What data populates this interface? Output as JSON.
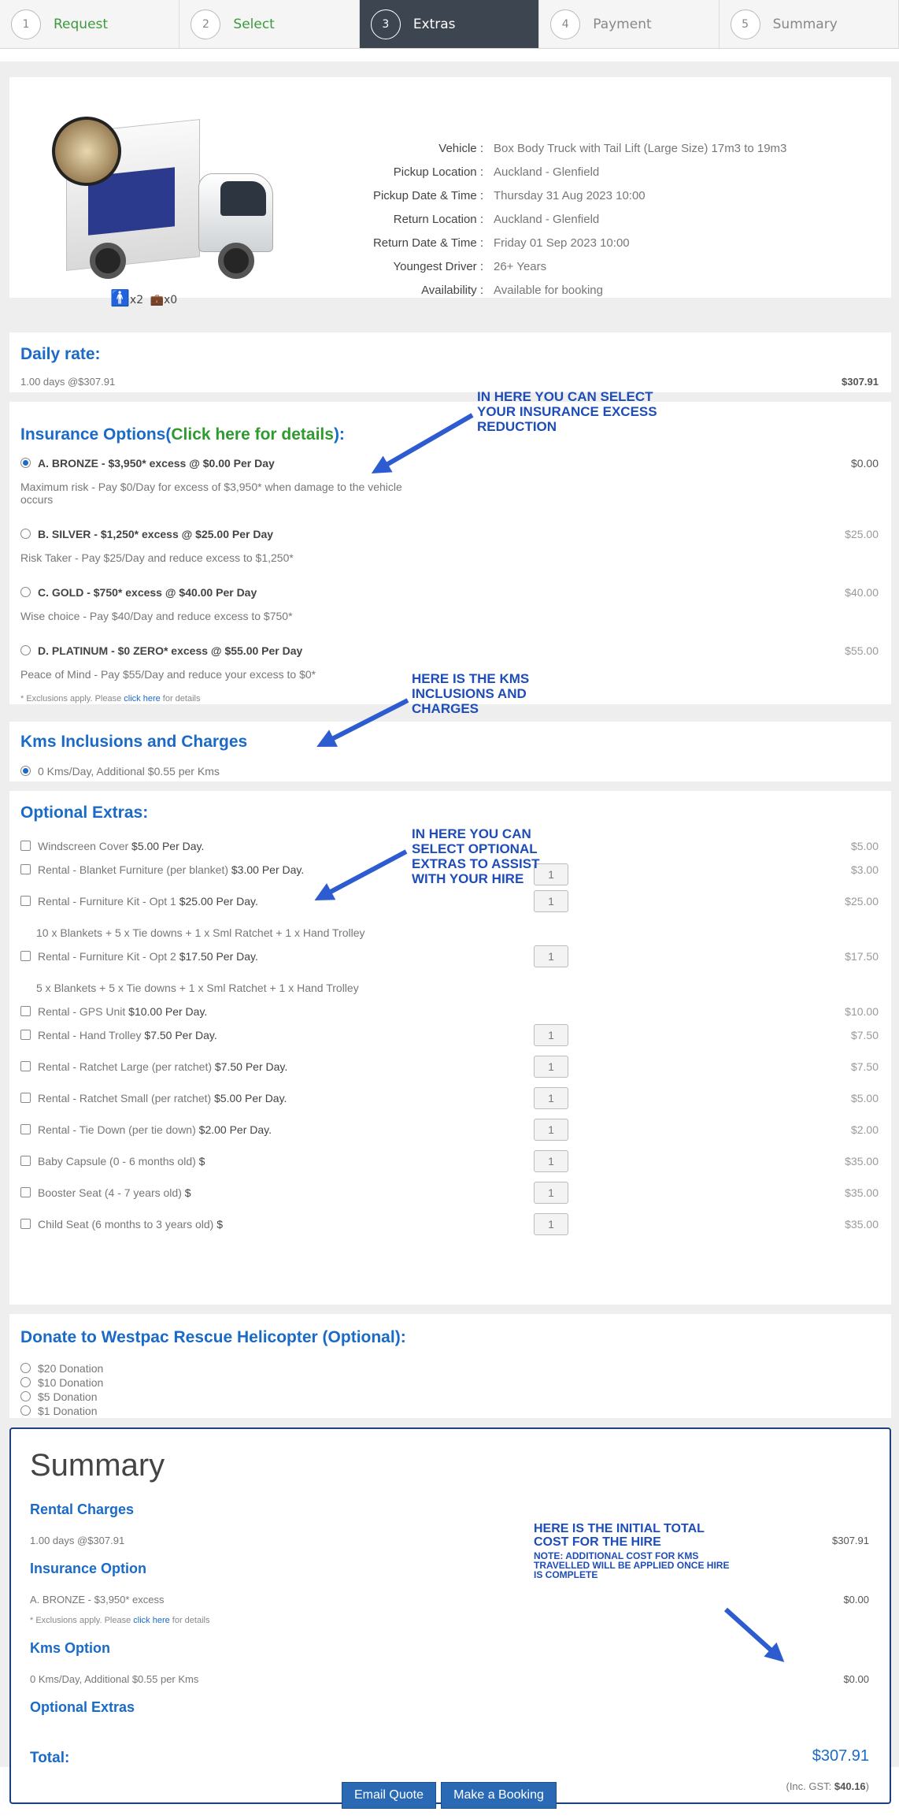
{
  "steps": [
    {
      "num": "1",
      "label": "Request"
    },
    {
      "num": "2",
      "label": "Select"
    },
    {
      "num": "3",
      "label": "Extras"
    },
    {
      "num": "4",
      "label": "Payment"
    },
    {
      "num": "5",
      "label": "Summary"
    }
  ],
  "vehicle": {
    "passengers": "x2",
    "luggage": "x0",
    "rows": [
      {
        "label": "Vehicle :",
        "value": "Box Body Truck with Tail Lift (Large Size) 17m3 to 19m3"
      },
      {
        "label": "Pickup Location :",
        "value": "Auckland - Glenfield"
      },
      {
        "label": "Pickup Date & Time :",
        "value": "Thursday 31 Aug 2023 10:00"
      },
      {
        "label": "Return Location :",
        "value": "Auckland - Glenfield"
      },
      {
        "label": "Return Date & Time :",
        "value": "Friday 01 Sep 2023 10:00"
      },
      {
        "label": "Youngest Driver :",
        "value": "26+ Years"
      },
      {
        "label": "Availability :",
        "value": "Available for booking"
      }
    ]
  },
  "daily": {
    "title": "Daily rate:",
    "desc": "1.00 days @$307.91",
    "price": "$307.91"
  },
  "insurance": {
    "title_a": "Insurance Options(",
    "title_link": "Click here for details",
    "title_b": "):",
    "options": [
      {
        "label": "A. BRONZE - $3,950* excess @ $0.00 Per Day",
        "desc": "Maximum risk - Pay $0/Day for excess of $3,950* when damage to the vehicle occurs",
        "price": "$0.00"
      },
      {
        "label": "B. SILVER - $1,250* excess @ $25.00 Per Day",
        "desc": "Risk Taker - Pay $25/Day and reduce excess to $1,250*",
        "price": "$25.00"
      },
      {
        "label": "C. GOLD - $750* excess @ $40.00 Per Day",
        "desc": "Wise choice - Pay $40/Day and reduce excess to $750*",
        "price": "$40.00"
      },
      {
        "label": "D. PLATINUM - $0 ZERO* excess @ $55.00 Per Day",
        "desc": "Peace of Mind - Pay $55/Day and reduce your excess to $0*",
        "price": "$55.00"
      }
    ],
    "excl_a": "* Exclusions apply. Please ",
    "excl_link": "click here",
    "excl_b": " for details"
  },
  "kms": {
    "title": "Kms Inclusions and Charges",
    "option": "0 Kms/Day, Additional $0.55 per Kms"
  },
  "extras": {
    "title": "Optional Extras:",
    "items": [
      {
        "name": "Windscreen Cover",
        "price_text": "$5.00 Per Day.",
        "price": "$5.00",
        "qty": ""
      },
      {
        "name": "Rental - Blanket Furniture (per blanket)",
        "price_text": "$3.00 Per Day.",
        "price": "$3.00",
        "qty": "1"
      },
      {
        "name": "Rental - Furniture Kit - Opt 1",
        "price_text": "$25.00 Per Day.",
        "price": "$25.00",
        "qty": "1",
        "sub": "10 x Blankets + 5 x Tie downs + 1 x Sml Ratchet + 1 x Hand Trolley"
      },
      {
        "name": "Rental - Furniture Kit - Opt 2",
        "price_text": "$17.50 Per Day.",
        "price": "$17.50",
        "qty": "1",
        "sub": "5 x Blankets + 5 x Tie downs + 1 x Sml Ratchet + 1 x Hand Trolley"
      },
      {
        "name": "Rental - GPS Unit",
        "price_text": "$10.00 Per Day.",
        "price": "$10.00",
        "qty": ""
      },
      {
        "name": "Rental - Hand Trolley",
        "price_text": "$7.50 Per Day.",
        "price": "$7.50",
        "qty": "1"
      },
      {
        "name": "Rental - Ratchet Large (per ratchet)",
        "price_text": "$7.50 Per Day.",
        "price": "$7.50",
        "qty": "1"
      },
      {
        "name": "Rental - Ratchet Small (per ratchet)",
        "price_text": "$5.00 Per Day.",
        "price": "$5.00",
        "qty": "1"
      },
      {
        "name": "Rental - Tie Down (per tie down)",
        "price_text": "$2.00 Per Day.",
        "price": "$2.00",
        "qty": "1"
      },
      {
        "name": "Baby Capsule (0 - 6 months old)",
        "price_text": "$",
        "price": "$35.00",
        "qty": "1"
      },
      {
        "name": "Booster Seat (4 - 7 years old)",
        "price_text": "$",
        "price": "$35.00",
        "qty": "1"
      },
      {
        "name": "Child Seat (6 months to 3 years old)",
        "price_text": "$",
        "price": "$35.00",
        "qty": "1"
      }
    ]
  },
  "donate": {
    "title": "Donate to Westpac Rescue Helicopter (Optional):",
    "options": [
      "$20 Donation",
      "$10 Donation",
      "$5 Donation",
      "$1 Donation"
    ]
  },
  "summary": {
    "title": "Summary",
    "rental_h": "Rental Charges",
    "rental_desc": "1.00 days @$307.91",
    "rental_price": "$307.91",
    "ins_h": "Insurance Option",
    "ins_desc": "A. BRONZE - $3,950* excess",
    "ins_price": "$0.00",
    "excl_a": "* Exclusions apply. Please ",
    "excl_link": "click here",
    "excl_b": " for details",
    "kms_h": "Kms Option",
    "kms_desc": "0 Kms/Day, Additional $0.55 per Kms",
    "kms_price": "$0.00",
    "extras_h": "Optional Extras",
    "total_label": "Total:",
    "total": "$307.91",
    "gst_a": "(Inc. GST: ",
    "gst_val": "$40.16",
    "gst_b": ")"
  },
  "notes": {
    "insurance": "IN HERE YOU CAN SELECT YOUR INSURANCE EXCESS REDUCTION",
    "kms": "HERE IS THE KMS INCLUSIONS AND CHARGES",
    "extras": "IN HERE YOU CAN SELECT OPTIONAL EXTRAS TO ASSIST WITH YOUR HIRE",
    "total": "HERE IS THE INITIAL TOTAL COST FOR THE HIRE",
    "total_sub": "NOTE: ADDITIONAL COST FOR KMS TRAVELLED WILL BE APPLIED ONCE HIRE IS COMPLETE"
  },
  "buttons": {
    "email": "Email Quote",
    "book": "Make a Booking"
  },
  "colors": {
    "accent": "#1a6ac7",
    "link_green": "#2f9a2f",
    "annotation": "#2d5bd0",
    "active_step": "#3d4551"
  }
}
